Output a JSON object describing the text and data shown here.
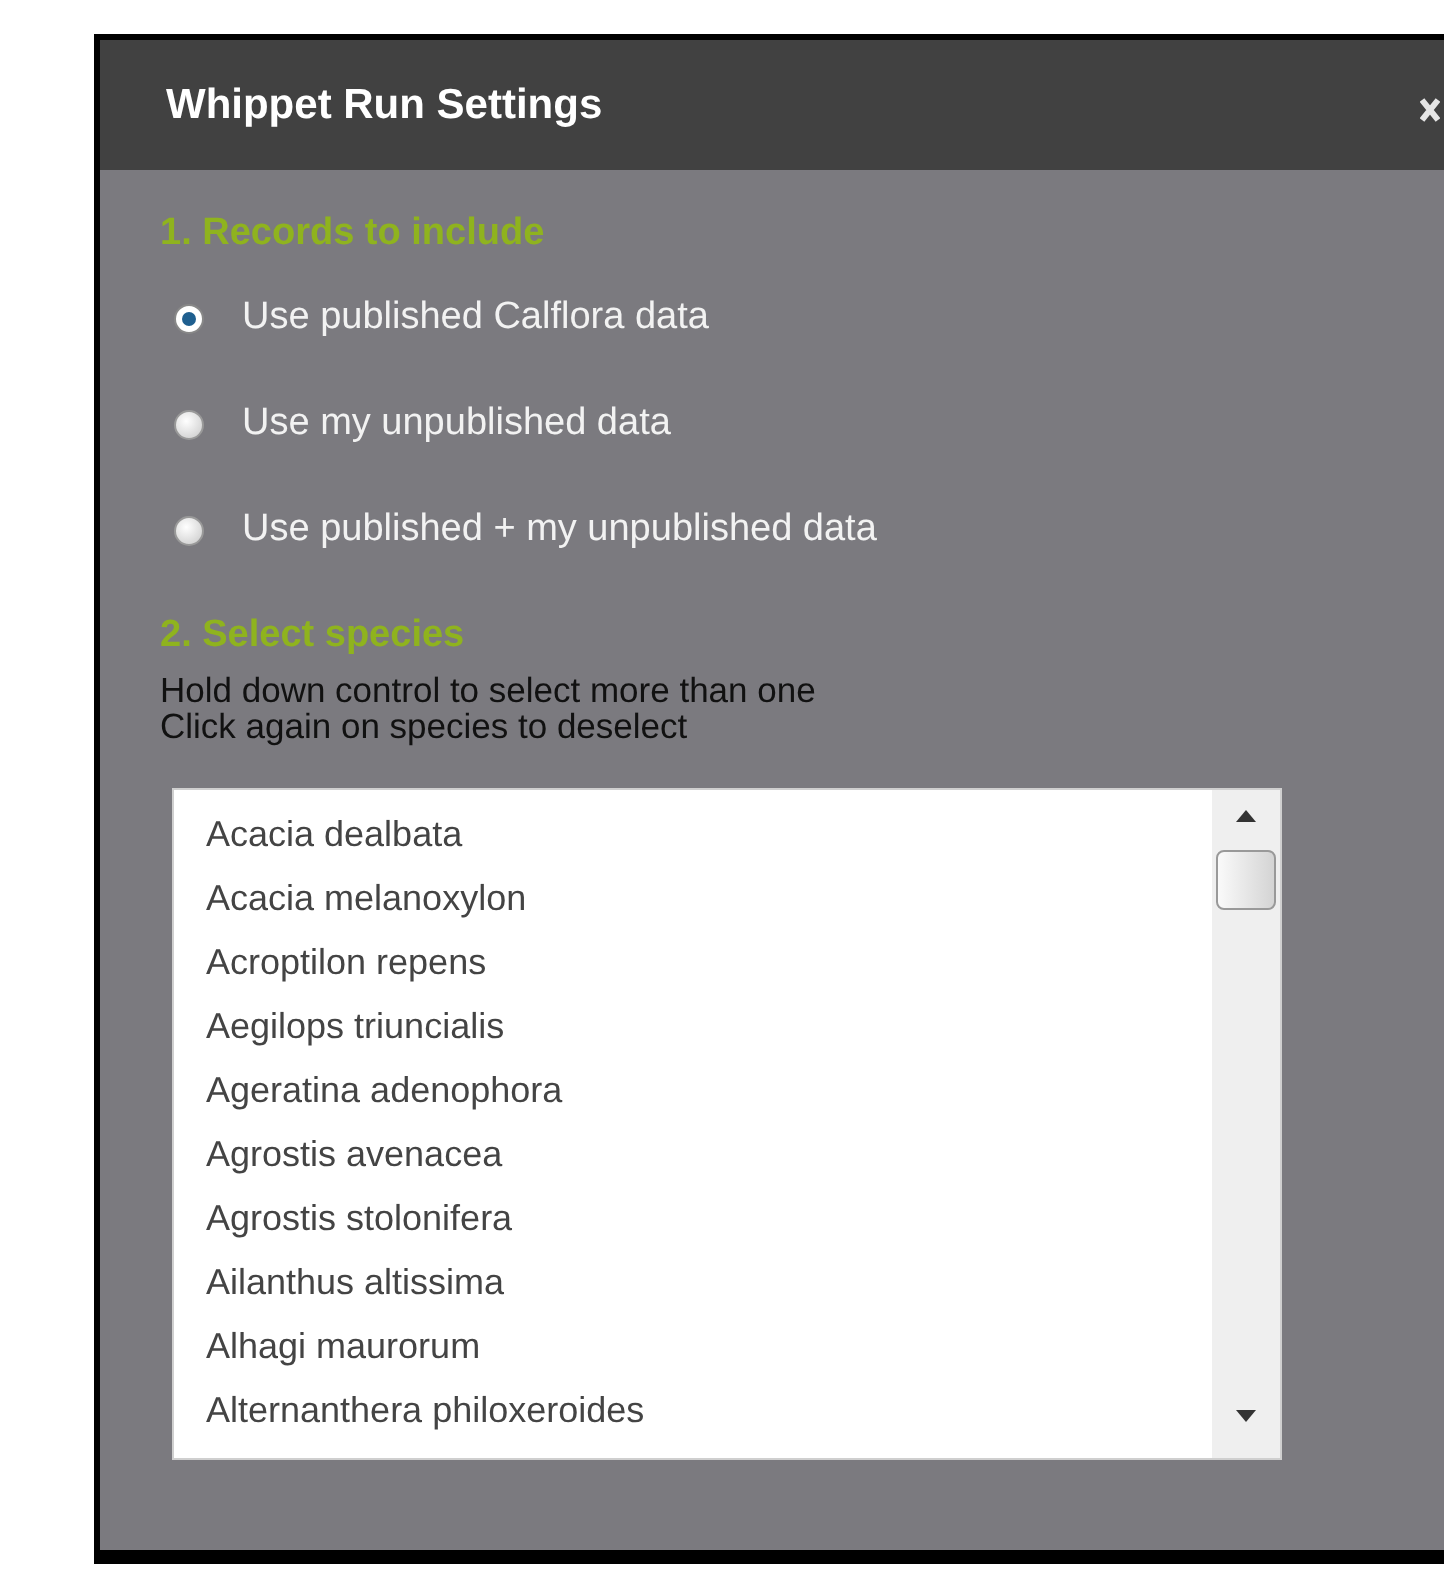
{
  "window": {
    "title": "Whippet Run Settings"
  },
  "records": {
    "heading": "1. Records to include",
    "options": [
      {
        "label": "Use published Calflora data",
        "selected": true
      },
      {
        "label": "Use my unpublished data",
        "selected": false
      },
      {
        "label": "Use published + my unpublished data",
        "selected": false
      }
    ]
  },
  "species": {
    "heading": "2. Select species",
    "instructions": [
      "Hold down control to select more than one",
      "Click again on species to deselect"
    ],
    "items": [
      {
        "label": "Acacia dealbata",
        "selected": false
      },
      {
        "label": "Acacia melanoxylon",
        "selected": false
      },
      {
        "label": "Acroptilon repens",
        "selected": false
      },
      {
        "label": "Aegilops triuncialis",
        "selected": false
      },
      {
        "label": "Ageratina adenophora",
        "selected": false
      },
      {
        "label": "Agrostis avenacea",
        "selected": false
      },
      {
        "label": "Agrostis stolonifera",
        "selected": false
      },
      {
        "label": "Ailanthus altissima",
        "selected": false
      },
      {
        "label": "Alhagi maurorum",
        "selected": false
      },
      {
        "label": "Alternanthera philoxeroides",
        "selected": false
      }
    ]
  }
}
